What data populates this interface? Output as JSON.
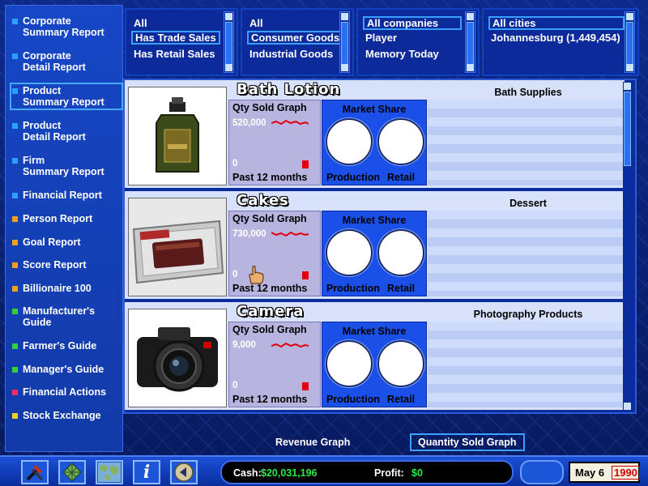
{
  "sidebar": {
    "items": [
      {
        "label_l1": "Corporate",
        "label_l2": "Summary Report",
        "color": "#2aa0ff",
        "active": false
      },
      {
        "label_l1": "Corporate",
        "label_l2": "Detail Report",
        "color": "#2aa0ff",
        "active": false
      },
      {
        "label_l1": "Product",
        "label_l2": "Summary Report",
        "color": "#2aa0ff",
        "active": true
      },
      {
        "label_l1": "Product",
        "label_l2": "Detail Report",
        "color": "#2aa0ff",
        "active": false
      },
      {
        "label_l1": "Firm",
        "label_l2": "Summary Report",
        "color": "#2aa0ff",
        "active": false
      },
      {
        "label_l1": "Financial Report",
        "label_l2": "",
        "color": "#2aa0ff",
        "active": false
      },
      {
        "label_l1": "Person Report",
        "label_l2": "",
        "color": "#f0a020",
        "active": false
      },
      {
        "label_l1": "Goal Report",
        "label_l2": "",
        "color": "#f0a020",
        "active": false
      },
      {
        "label_l1": "Score Report",
        "label_l2": "",
        "color": "#f0a020",
        "active": false
      },
      {
        "label_l1": "Billionaire 100",
        "label_l2": "",
        "color": "#f0a020",
        "active": false
      },
      {
        "label_l1": "Manufacturer's",
        "label_l2": "Guide",
        "color": "#30d040",
        "active": false
      },
      {
        "label_l1": "Farmer's Guide",
        "label_l2": "",
        "color": "#30d040",
        "active": false
      },
      {
        "label_l1": "Manager's Guide",
        "label_l2": "",
        "color": "#30d040",
        "active": false
      },
      {
        "label_l1": "Financial Actions",
        "label_l2": "",
        "color": "#ff2a6a",
        "active": false
      },
      {
        "label_l1": "Stock Exchange",
        "label_l2": "",
        "color": "#f0d020",
        "active": false
      }
    ]
  },
  "filters": {
    "sales_type": {
      "options": [
        "All",
        "Has Trade Sales",
        "Has Retail Sales"
      ],
      "selected": 1
    },
    "goods_type": {
      "options": [
        "All",
        "Consumer Goods",
        "Industrial Goods"
      ],
      "selected": 1
    },
    "companies": {
      "options": [
        "All companies",
        "Player",
        "Memory Today"
      ],
      "selected": 0
    },
    "cities": {
      "options": [
        "All cities",
        "Johannesburg (1,449,454)"
      ],
      "selected": 0
    }
  },
  "labels": {
    "qty_title": "Qty Sold Graph",
    "qty_period": "Past 12 months",
    "qty_min": "0",
    "market_title": "Market Share",
    "production": "Production",
    "retail": "Retail"
  },
  "products": [
    {
      "name": "Bath Lotion",
      "category": "Bath Supplies",
      "qty_max": "520,000",
      "image_icon": "bath-lotion-bottle-icon"
    },
    {
      "name": "Cakes",
      "category": "Dessert",
      "qty_max": "730,000",
      "image_icon": "cakes-tray-icon"
    },
    {
      "name": "Camera",
      "category": "Photography Products",
      "qty_max": "9,000",
      "image_icon": "camera-icon"
    }
  ],
  "graph_toggle": {
    "revenue": "Revenue Graph",
    "quantity": "Quantity Sold Graph",
    "active": "quantity"
  },
  "status": {
    "cash_label": "Cash:",
    "cash_value": "$20,031,196",
    "profit_label": "Profit:",
    "profit_value": "$0",
    "date": "May 6",
    "year": "1990"
  },
  "toolbar": {
    "info_glyph": "i"
  }
}
